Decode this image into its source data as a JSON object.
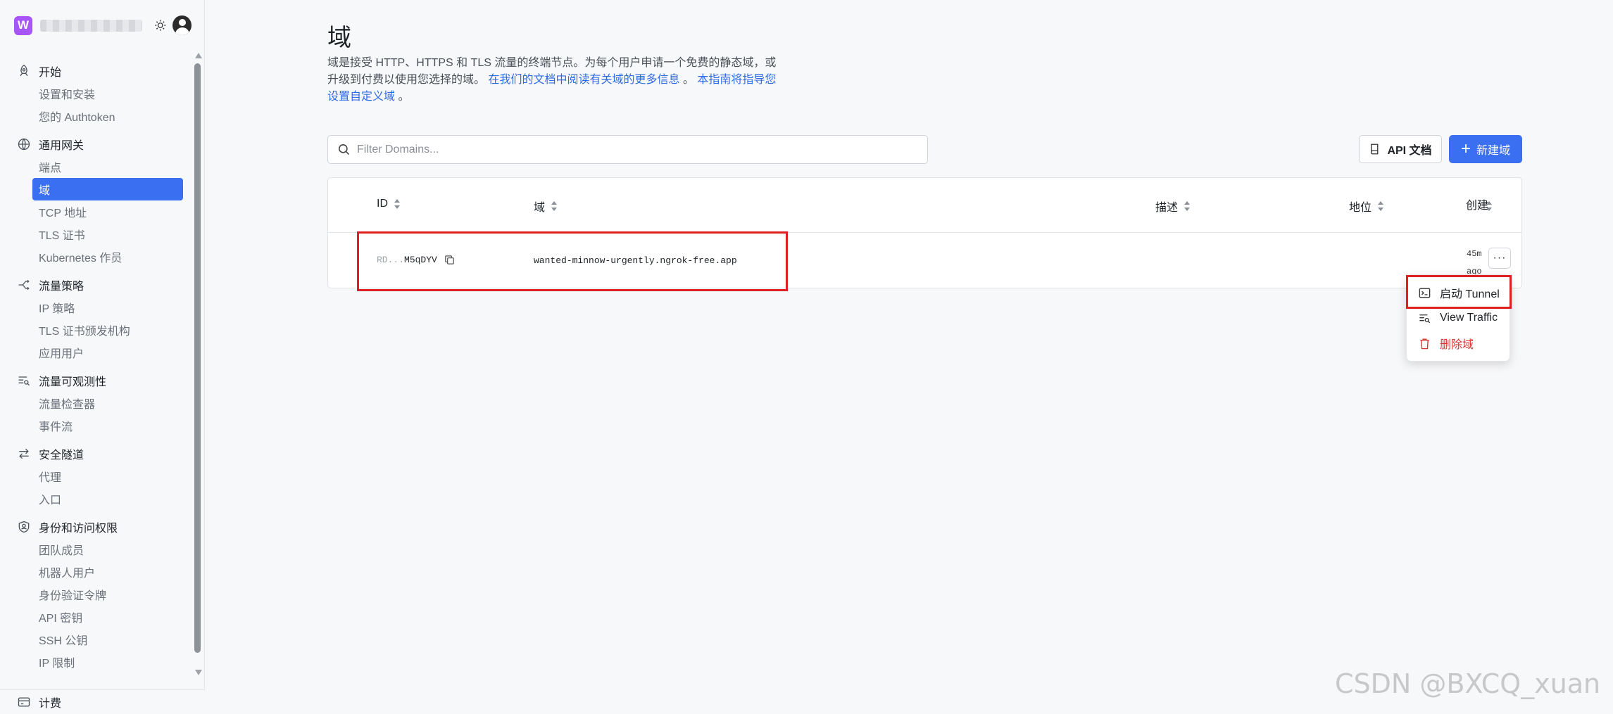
{
  "workspace": {
    "badge": "W"
  },
  "sidebar": {
    "groups": [
      {
        "title": "开始",
        "icon": "rocket-icon",
        "items": [
          "设置和安装",
          "您的 Authtoken"
        ]
      },
      {
        "title": "通用网关",
        "icon": "globe-icon",
        "items": [
          "端点",
          "域",
          "TCP 地址",
          "TLS 证书",
          "Kubernetes 作员"
        ]
      },
      {
        "title": "流量策略",
        "icon": "branch-icon",
        "items": [
          "IP 策略",
          "TLS 证书颁发机构",
          "应用用户"
        ]
      },
      {
        "title": "流量可观测性",
        "icon": "traffic-search-icon",
        "items": [
          "流量检查器",
          "事件流"
        ]
      },
      {
        "title": "安全隧道",
        "icon": "arrows-icon",
        "items": [
          "代理",
          "入口"
        ]
      },
      {
        "title": "身份和访问权限",
        "icon": "shield-icon",
        "items": [
          "团队成员",
          "机器人用户",
          "身份验证令牌",
          "API 密钥",
          "SSH 公钥",
          "IP 限制"
        ]
      }
    ],
    "active_item": "域",
    "footer": {
      "label": "计费",
      "icon": "billing-icon"
    }
  },
  "page": {
    "title": "域",
    "description_text": "域是接受 HTTP、HTTPS 和 TLS 流量的终端节点。为每个用户申请一个免费的静态域，或升级到付费以使用您选择的域。",
    "description_link1": "在我们的文档中阅读有关域的更多信息",
    "description_sep": "。",
    "description_link2": "本指南将指导您设置自定义域",
    "description_end": "。"
  },
  "toolbar": {
    "search_placeholder": "Filter Domains...",
    "api_docs_label": "API 文档",
    "new_domain_label": "新建域"
  },
  "table": {
    "headers": {
      "id": "ID",
      "domain": "域",
      "description": "描述",
      "region": "地位",
      "created_top": "创",
      "created_bottom": "建"
    },
    "rows": [
      {
        "id_prefix": "RD...",
        "id_suffix": "M5qDYV",
        "domain": "wanted-minnow-urgently.ngrok-free.app",
        "description": "",
        "region": "",
        "created_top": "45m",
        "created_bottom": "ago"
      }
    ]
  },
  "row_menu": {
    "items": [
      {
        "label": "启动 Tunnel",
        "icon": "terminal-icon"
      },
      {
        "label": "View Traffic",
        "icon": "traffic-search-icon"
      },
      {
        "label": "删除域",
        "icon": "trash-icon",
        "danger": true
      }
    ]
  },
  "colors": {
    "accent": "#3b6ff2",
    "highlight": "#e02020",
    "danger": "#d93030",
    "workspace_badge": "#a855f7"
  },
  "watermark": "CSDN @BXCQ_xuan"
}
